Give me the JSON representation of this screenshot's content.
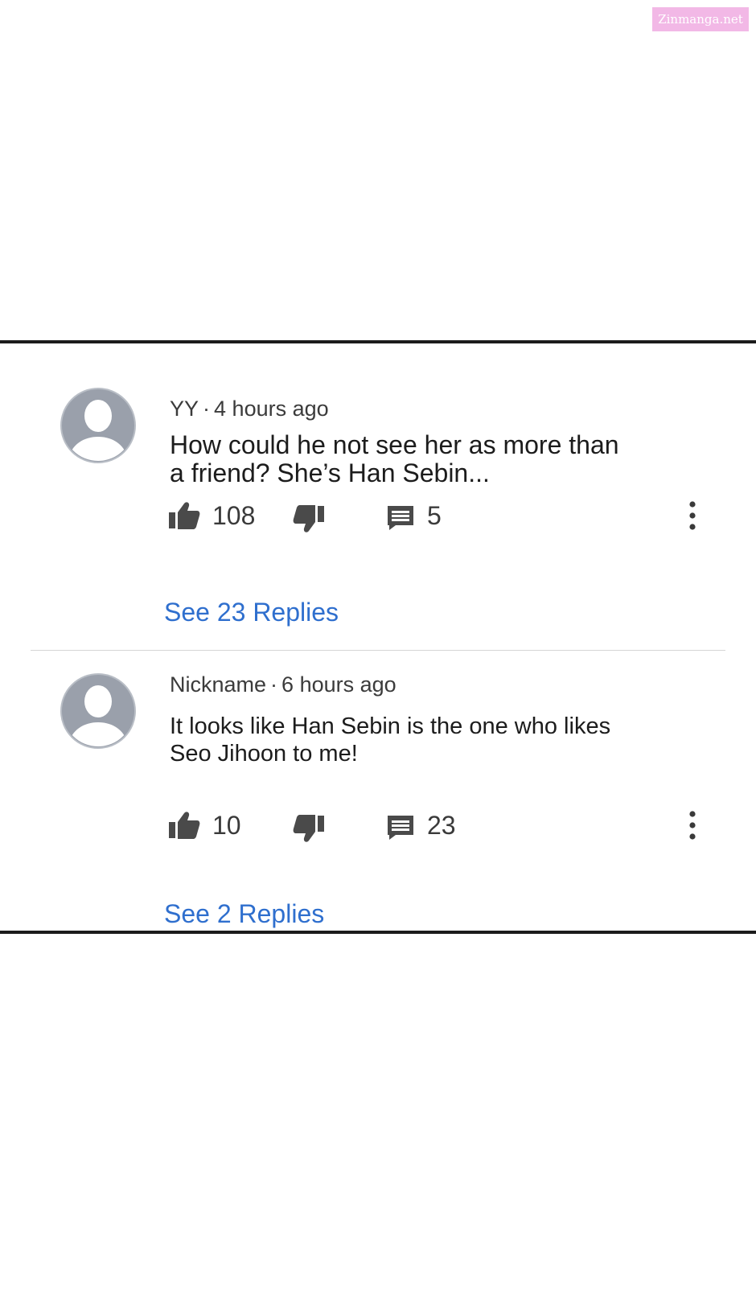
{
  "watermark": "Zinmanga.net",
  "comments": [
    {
      "author": "YY",
      "time": "4 hours ago",
      "text_lines": [
        "How could he not see her as more than",
        "a friend? She’s Han Sebin..."
      ],
      "likes": "108",
      "replies_count": "5",
      "see_replies": "See 23 Replies"
    },
    {
      "author": "Nickname",
      "time": "6 hours ago",
      "text_lines": [
        "It looks like Han Sebin is the one who likes",
        "Seo Jihoon to me!"
      ],
      "likes": "10",
      "replies_count": "23",
      "see_replies": "See 2 Replies"
    }
  ],
  "icons": {
    "avatar": "default-avatar-icon",
    "like": "thumbs-up-icon",
    "dislike": "thumbs-down-icon",
    "reply": "comment-icon",
    "more": "more-vertical-icon"
  },
  "colors": {
    "link": "#2f6fce",
    "icon": "#4a4a4a",
    "avatar": "#9aa0ab",
    "watermark_bg": "#f2b8e6"
  }
}
